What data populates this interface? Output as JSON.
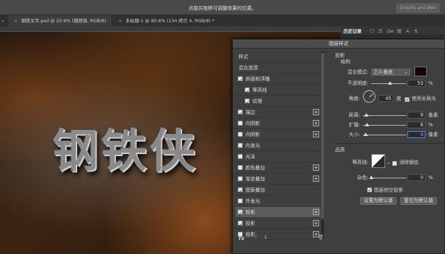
{
  "options_bar": {
    "hint": "点按并拖移可调整效果的位置。",
    "workspace": "Graphic and Web"
  },
  "tabs": [
    {
      "label": "钢铁文字.psd @ 20.9% (钢铁侠, RGB/8)"
    },
    {
      "label": "未标题-1 @ 80.6% (134 拷贝 4, RGB/8) *"
    }
  ],
  "canvas": {
    "text": "钢铁侠"
  },
  "right_panel": {
    "tabs": [
      "历史记录",
      "☐",
      "☰",
      "De",
      "图",
      "A",
      "¶"
    ]
  },
  "dialog": {
    "title": "图层样式",
    "styles_header": "样式",
    "blend_options": "混合选项",
    "effects": [
      {
        "label": "斜面和浮雕",
        "checked": true,
        "indent": false,
        "plus": false
      },
      {
        "label": "等高线",
        "checked": true,
        "indent": true,
        "plus": false
      },
      {
        "label": "纹理",
        "checked": true,
        "indent": true,
        "plus": false
      },
      {
        "label": "描边",
        "checked": true,
        "indent": false,
        "plus": true
      },
      {
        "label": "内阴影",
        "checked": false,
        "indent": false,
        "plus": true
      },
      {
        "label": "内阴影",
        "checked": false,
        "indent": false,
        "plus": true
      },
      {
        "label": "内发光",
        "checked": false,
        "indent": false,
        "plus": false
      },
      {
        "label": "光泽",
        "checked": false,
        "indent": false,
        "plus": false
      },
      {
        "label": "颜色叠加",
        "checked": false,
        "indent": false,
        "plus": true
      },
      {
        "label": "渐变叠加",
        "checked": false,
        "indent": false,
        "plus": true
      },
      {
        "label": "图案叠加",
        "checked": true,
        "indent": false,
        "plus": false
      },
      {
        "label": "外发光",
        "checked": false,
        "indent": false,
        "plus": false
      },
      {
        "label": "投影",
        "checked": true,
        "indent": false,
        "plus": true,
        "selected": true
      },
      {
        "label": "投影",
        "checked": true,
        "indent": false,
        "plus": true
      },
      {
        "label": "投影",
        "checked": false,
        "indent": false,
        "plus": true
      }
    ],
    "fx": "fx",
    "shadow": {
      "section": "投影",
      "structure": "结构",
      "blend_mode_label": "混合模式:",
      "blend_mode_value": "正片叠底",
      "shadow_color": "#140402",
      "opacity_label": "不透明度:",
      "opacity_value": "53",
      "opacity_unit": "%",
      "angle_label": "角度:",
      "angle_value": "45",
      "angle_unit": "度",
      "global_light_label": "使用全局光",
      "distance_label": "距离:",
      "distance_value": "9",
      "distance_unit": "像素",
      "spread_label": "扩展:",
      "spread_value": "6",
      "spread_unit": "%",
      "size_label": "大小:",
      "size_value": "4",
      "size_unit": "像素",
      "quality": "品质",
      "contour_label": "等高线:",
      "antialias_label": "消除锯齿",
      "noise_label": "杂色:",
      "noise_value": "0",
      "noise_unit": "%",
      "knockout_label": "图层挖空投影",
      "default_button": "设置为默认值",
      "reset_button": "复位为默认值"
    }
  }
}
